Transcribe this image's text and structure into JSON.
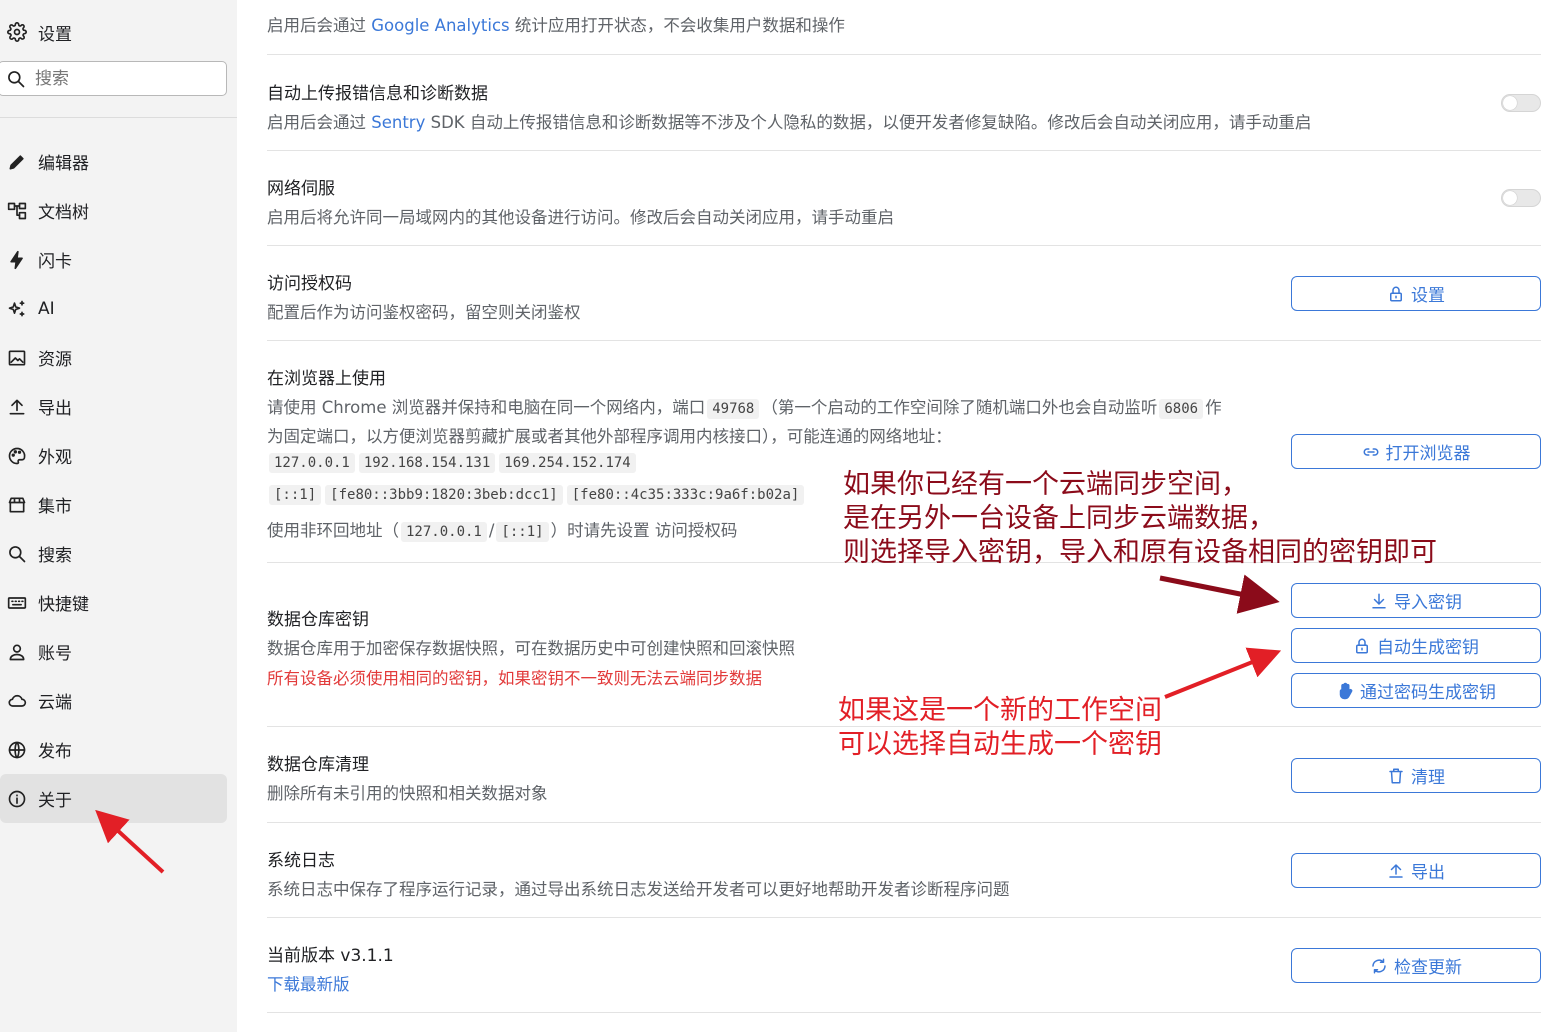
{
  "sidebar": {
    "title": "设置",
    "search_placeholder": "搜索",
    "items": [
      {
        "label": "编辑器",
        "icon": "pencil-icon"
      },
      {
        "label": "文档树",
        "icon": "tree-icon"
      },
      {
        "label": "闪卡",
        "icon": "lightning-icon"
      },
      {
        "label": "AI",
        "icon": "sparkle-icon"
      },
      {
        "label": "资源",
        "icon": "image-icon"
      },
      {
        "label": "导出",
        "icon": "upload-icon"
      },
      {
        "label": "外观",
        "icon": "palette-icon"
      },
      {
        "label": "集市",
        "icon": "store-icon"
      },
      {
        "label": "搜索",
        "icon": "search-icon"
      },
      {
        "label": "快捷键",
        "icon": "keyboard-icon"
      },
      {
        "label": "账号",
        "icon": "user-icon"
      },
      {
        "label": "云端",
        "icon": "cloud-icon"
      },
      {
        "label": "发布",
        "icon": "globe-icon"
      },
      {
        "label": "关于",
        "icon": "info-icon",
        "active": true
      }
    ]
  },
  "main": {
    "analytics": {
      "desc_prefix": "启用后会通过",
      "desc_link": "Google Analytics",
      "desc_suffix": "统计应用打开状态，不会收集用户数据和操作"
    },
    "sentry": {
      "title": "自动上传报错信息和诊断数据",
      "desc_prefix": "启用后会通过",
      "desc_link": "Sentry",
      "desc_suffix": "SDK 自动上传报错信息和诊断数据等不涉及个人隐私的数据，以便开发者修复缺陷。修改后会自动关闭应用，请手动重启",
      "enabled": false
    },
    "network_serve": {
      "title": "网络伺服",
      "desc": "启用后将允许同一局域网内的其他设备进行访问。修改后会自动关闭应用，请手动重启",
      "enabled": false
    },
    "auth_code": {
      "title": "访问授权码",
      "desc": "配置后作为访问鉴权密码，留空则关闭鉴权",
      "button": "设置"
    },
    "browser": {
      "title": "在浏览器上使用",
      "line1_a": "请使用 Chrome 浏览器并保持和电脑在同一个网络内，端口",
      "port": "49768",
      "line1_b": "（第一个启动的工作空间除了随机端口外也会自动监听",
      "fixed_port": "6806",
      "line1_c": "作",
      "line2": "为固定端口，以方便浏览器剪藏扩展或者其他外部程序调用内核接口），可能连通的网络地址：",
      "addresses_1": [
        "127.0.0.1",
        "192.168.154.131",
        "169.254.152.174"
      ],
      "addresses_2": [
        "[::1]",
        "[fe80::3bb9:1820:3beb:dcc1]",
        "[fe80::4c35:333c:9a6f:b02a]"
      ],
      "line3_a": "使用非环回地址（",
      "loop1": "127.0.0.1",
      "slash": "/",
      "loop2": "[::1]",
      "line3_b": "）时请先设置 访问授权码",
      "button": "打开浏览器"
    },
    "repo_key": {
      "title": "数据仓库密钥",
      "desc": "数据仓库用于加密保存数据快照，可在数据历史中可创建快照和回滚快照",
      "warning": "所有设备必须使用相同的密钥，如果密钥不一致则无法云端同步数据",
      "btn_import": "导入密钥",
      "btn_auto": "自动生成密钥",
      "btn_password": "通过密码生成密钥"
    },
    "repo_purge": {
      "title": "数据仓库清理",
      "desc": "删除所有未引用的快照和相关数据对象",
      "button": "清理"
    },
    "syslog": {
      "title": "系统日志",
      "desc": "系统日志中保存了程序运行记录，通过导出系统日志发送给开发者可以更好地帮助开发者诊断程序问题",
      "button": "导出"
    },
    "version": {
      "title": "当前版本 v3.1.1",
      "link": "下载最新版",
      "button": "检查更新"
    }
  },
  "annotations": {
    "existing_cloud": [
      "如果你已经有一个云端同步空间，",
      "是在另外一台设备上同步云端数据，",
      "则选择导入密钥，导入和原有设备相同的密钥即可"
    ],
    "new_workspace": [
      "如果这是一个新的工作空间",
      "可以选择自动生成一个密钥"
    ],
    "colors": {
      "dark_red": "#8b0b1a",
      "red": "#e21f26",
      "link": "#3b78d8"
    }
  }
}
